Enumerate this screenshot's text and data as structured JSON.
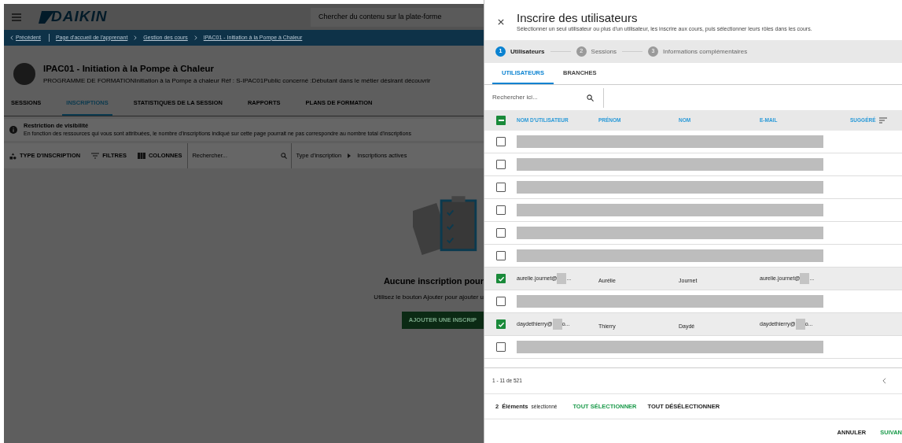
{
  "app": {
    "logo": "DAIKIN",
    "search_placeholder": "Chercher du contenu sur la plate-forme",
    "breadcrumbs": [
      {
        "label": "Précédent",
        "kind": "back"
      },
      {
        "label": "Page d'accueil de l'apprenant",
        "kind": "link"
      },
      {
        "label": "Gestion des cours",
        "kind": "link"
      },
      {
        "label": "IPAC01 - Initiation à la Pompe à Chaleur",
        "kind": "link"
      }
    ],
    "course": {
      "title": "IPAC01 - Initiation à la Pompe à Chaleur",
      "description": "PROGRAMME DE FORMATIONInitiation à la Pompe à chaleur Réf : S-IPAC01Public concerné :Débutant dans le métier désirant découvrir"
    },
    "tabs": [
      {
        "label": "SESSIONS",
        "selected": false
      },
      {
        "label": "INSCRIPTIONS",
        "selected": true
      },
      {
        "label": "STATISTIQUES DE LA SESSION",
        "selected": false
      },
      {
        "label": "RAPPORTS",
        "selected": false
      },
      {
        "label": "PLANS DE FORMATION",
        "selected": false
      }
    ],
    "notice": {
      "title": "Restriction de visibilité",
      "text": "En fonction des ressources qui vous sont attribuées, le nombre d'inscriptions indiqué sur cette page pourrait ne pas correspondre au nombre total d'inscriptions"
    },
    "toolbar": {
      "buttons": [
        {
          "label": "TYPE D'INSCRIPTION",
          "kind": "type"
        },
        {
          "label": "FILTRES",
          "kind": "filter"
        },
        {
          "label": "COLONNES",
          "kind": "columns"
        }
      ],
      "search_placeholder": "Rechercher...",
      "filter_path": [
        "Type d'inscription",
        "Inscriptions actives"
      ]
    },
    "empty_state": {
      "title": "Aucune inscription pour",
      "text": "Utilisez le bouton Ajouter pour ajouter u",
      "button": "AJOUTER UNE INSCRIP"
    }
  },
  "dialog": {
    "title": "Inscrire des utilisateurs",
    "subtitle": "Sélectionner un seul utilisateur ou plus d'un utilisateur, les inscrire aux cours, puis sélectionner leurs rôles dans les cours.",
    "steps": [
      {
        "number": "1",
        "label": "Utilisateurs",
        "selected": true
      },
      {
        "number": "2",
        "label": "Sessions",
        "selected": false
      },
      {
        "number": "3",
        "label": "Informations complémentaires",
        "selected": false
      }
    ],
    "tabs": [
      {
        "label": "UTILISATEURS",
        "selected": true
      },
      {
        "label": "BRANCHES",
        "selected": false
      }
    ],
    "search_placeholder": "Rechercher ici...",
    "table": {
      "partial_selection": true,
      "columns": [
        "NOM D'UTILISATEUR",
        "PRÉNOM",
        "NOM",
        "E-MAIL",
        "SUGGÉRÉ"
      ],
      "rows": [
        {
          "kind": "redacted",
          "checked": false
        },
        {
          "kind": "redacted",
          "checked": false
        },
        {
          "kind": "redacted",
          "checked": false
        },
        {
          "kind": "redacted",
          "checked": false
        },
        {
          "kind": "redacted",
          "checked": false
        },
        {
          "kind": "redacted",
          "checked": false
        },
        {
          "kind": "user",
          "checked": true,
          "username": "aurelie.journet@",
          "username_end": "...",
          "first_name": "Aurélie",
          "last_name": "Journet",
          "email": "aurelie.journet@",
          "email_end": "..."
        },
        {
          "kind": "redacted",
          "checked": false
        },
        {
          "kind": "user",
          "checked": true,
          "username": "daydethierry@",
          "username_end": "o...",
          "first_name": "Thierry",
          "last_name": "Daydé",
          "email": "daydethierry@",
          "email_end": "o..."
        },
        {
          "kind": "redacted",
          "checked": false
        }
      ]
    },
    "pagination": "1 - 11 de 521",
    "selection": {
      "count": "2",
      "label": "Éléments",
      "suffix": "sélectionné",
      "select_all": "TOUT SÉLECTIONNER",
      "deselect_all": "TOUT DÉSÉLECTIONNER"
    },
    "actions": [
      {
        "label": "ANNULER",
        "kind": "secondary"
      },
      {
        "label": "SUIVAN",
        "kind": "primary"
      }
    ]
  }
}
